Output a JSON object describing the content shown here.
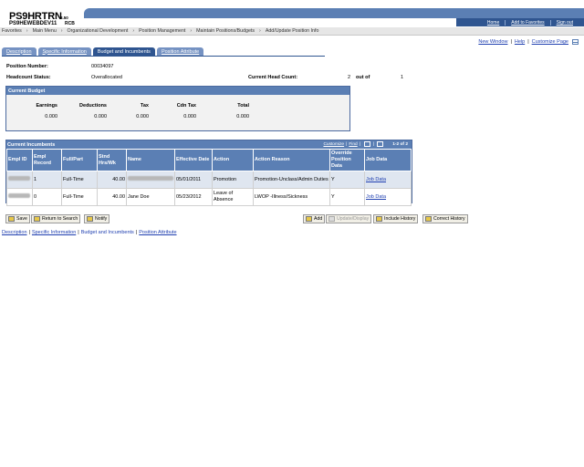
{
  "brand": {
    "title": "PS9HRTRN",
    "version": "8.50",
    "database": "PS9HEWEBDEV11",
    "user": "RCB"
  },
  "header_links": [
    "Home",
    "Add to Favorites",
    "Sign out"
  ],
  "navbar": {
    "items": [
      "Favorites",
      "Main Menu",
      "Organizational Development",
      "Position Management",
      "Maintain Positions/Budgets",
      "Add/Update Position Info"
    ]
  },
  "top_links": {
    "new_window": "New Window",
    "help": "Help",
    "customize_page": "Customize Page"
  },
  "tabs": [
    {
      "label": "Description",
      "active": false
    },
    {
      "label": "Specific Information",
      "active": false
    },
    {
      "label": "Budget and Incumbents",
      "active": true
    },
    {
      "label": "Position Attribute",
      "active": false
    }
  ],
  "position": {
    "number_label": "Position Number:",
    "number": "00034097",
    "status_label": "Headcount Status:",
    "status": "Overallocated",
    "headcount_label": "Current Head Count:",
    "headcount": "2",
    "out_of": "out of",
    "max": "1"
  },
  "budget": {
    "title": "Current Budget",
    "columns": [
      {
        "header": "Earnings",
        "value": "0.000"
      },
      {
        "header": "Deductions",
        "value": "0.000"
      },
      {
        "header": "Tax",
        "value": "0.000"
      },
      {
        "header": "Cdn Tax",
        "value": "0.000"
      },
      {
        "header": "Total",
        "value": "0.000"
      }
    ]
  },
  "incumbents": {
    "title": "Current Incumbents",
    "customize": "Customize",
    "find": "Find",
    "page_info": "1-2 of 2",
    "headers": [
      "Empl ID",
      "Empl Record",
      "Full/Part",
      "Stnd Hrs/Wk",
      "Name",
      "Effective Date",
      "Action",
      "Action Reason",
      "Override Position Data",
      "Job Data"
    ],
    "rows": [
      {
        "empl_record": "1",
        "full_part": "Full-Time",
        "hours": "40.00",
        "name": "",
        "eff_date": "05/01/2011",
        "action": "Promotion",
        "reason": "Promotion-Unclass/Admin Duties",
        "override": "Y",
        "job_data": "Job Data"
      },
      {
        "empl_record": "0",
        "full_part": "Full-Time",
        "hours": "40.00",
        "name": "Jane Doe",
        "eff_date": "05/23/2012",
        "action": "Leave of Absence",
        "reason": "LWOP -Illness/Sickness",
        "override": "Y",
        "job_data": "Job Data"
      }
    ]
  },
  "buttons": {
    "save": "Save",
    "return_to_search": "Return to Search",
    "notify": "Notify",
    "add": "Add",
    "update_display": "Update/Display",
    "include_history": "Include History",
    "correct_history": "Correct History"
  },
  "bottom_links": [
    "Description",
    "Specific Information",
    "Budget and Incumbents",
    "Position Attribute"
  ],
  "colors": {
    "header_blue": "#5b7fb4",
    "dark_blue": "#2f5590",
    "link": "#1f3fb0"
  }
}
